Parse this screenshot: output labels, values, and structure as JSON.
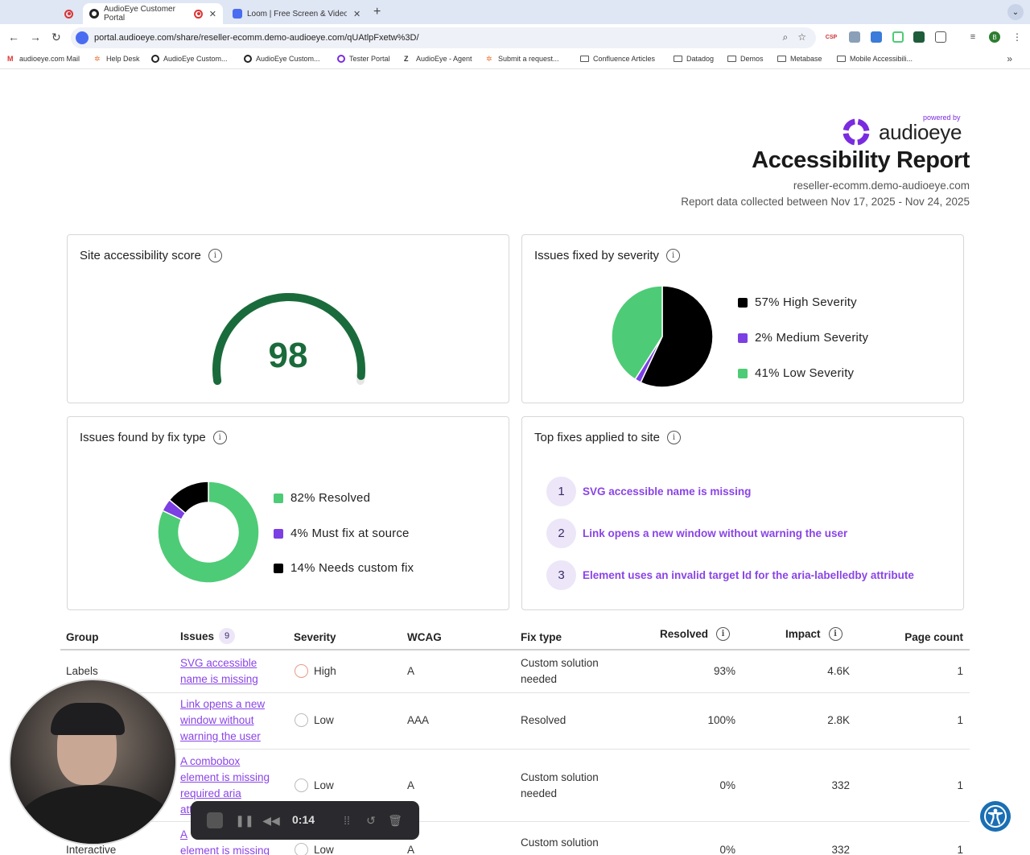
{
  "browser": {
    "tabs": [
      {
        "label": ""
      },
      {
        "label": "AudioEye Customer Portal"
      },
      {
        "label": "Loom | Free Screen & Video R"
      }
    ],
    "url": "portal.audioeye.com/share/reseller-ecomm.demo-audioeye.com/qUAtlpFxetw%3D/",
    "extensions": {
      "csp": "CSP",
      "profile": "B"
    },
    "bookmarks": [
      "audioeye.com Mail",
      "Help Desk",
      "AudioEye Custom...",
      "AudioEye Custom...",
      "Tester Portal",
      "AudioEye - Agent",
      "Submit a request...",
      "Confluence Articles",
      "Datadog",
      "Demos",
      "Metabase",
      "Mobile Accessibili..."
    ],
    "bookmarks_more": "»"
  },
  "header": {
    "powered_by": "powered by",
    "brand": "audioeye",
    "title": "Accessibility Report",
    "domain": "reseller-ecomm.demo-audioeye.com",
    "dates": "Report data collected between Nov 17, 2025 - Nov 24, 2025"
  },
  "score_card": {
    "title": "Site accessibility score",
    "score": "98",
    "score_fraction": 0.98,
    "color": "#1a6b3b"
  },
  "severity_card": {
    "title": "Issues fixed by severity",
    "items": [
      {
        "label": "57% High Severity",
        "pct": 57,
        "color": "#000000"
      },
      {
        "label": "2% Medium Severity",
        "pct": 2,
        "color": "#7b3fe4"
      },
      {
        "label": "41% Low Severity",
        "pct": 41,
        "color": "#4ecb76"
      }
    ]
  },
  "fixtype_card": {
    "title": "Issues found by fix type",
    "items": [
      {
        "label": "82% Resolved",
        "pct": 82,
        "color": "#4ecb76"
      },
      {
        "label": "4% Must fix at source",
        "pct": 4,
        "color": "#7b3fe4"
      },
      {
        "label": "14% Needs custom fix",
        "pct": 14,
        "color": "#000000"
      }
    ]
  },
  "topfixes_card": {
    "title": "Top fixes applied to site",
    "items": [
      {
        "num": "1",
        "label": "SVG accessible name is missing"
      },
      {
        "num": "2",
        "label": "Link opens a new window without warning the user"
      },
      {
        "num": "3",
        "label": "Element uses an invalid target Id for the aria-labelledby attribute"
      }
    ]
  },
  "table": {
    "headers": {
      "group": "Group",
      "issues": "Issues",
      "issues_count": "9",
      "severity": "Severity",
      "wcag": "WCAG",
      "fix_type": "Fix type",
      "resolved": "Resolved",
      "impact": "Impact",
      "page_count": "Page count"
    },
    "rows": [
      {
        "group": "Labels",
        "issue_lines": [
          "SVG accessible",
          "name is missing"
        ],
        "severity": "High",
        "wcag": "A",
        "fix_lines": [
          "Custom solution",
          "needed"
        ],
        "resolved": "93%",
        "impact": "4.6K",
        "page_count": "1"
      },
      {
        "group": "",
        "issue_lines": [
          "Link opens a new",
          "window without",
          "warning the user"
        ],
        "severity": "Low",
        "wcag": "AAA",
        "fix_lines": [
          "Resolved"
        ],
        "resolved": "100%",
        "impact": "2.8K",
        "page_count": "1"
      },
      {
        "group": "",
        "issue_lines": [
          "A combobox",
          "element is missing",
          "required aria",
          "att"
        ],
        "severity": "Low",
        "wcag": "A",
        "fix_lines": [
          "Custom solution",
          "needed"
        ],
        "resolved": "0%",
        "impact": "332",
        "page_count": "1"
      },
      {
        "group": "Interactive",
        "issue_lines": [
          "A",
          "element is missing"
        ],
        "severity": "Low",
        "wcag": "A",
        "fix_lines": [
          "Custom solution"
        ],
        "resolved": "0%",
        "impact": "332",
        "page_count": "1"
      }
    ]
  },
  "loom": {
    "time": "0:14"
  }
}
